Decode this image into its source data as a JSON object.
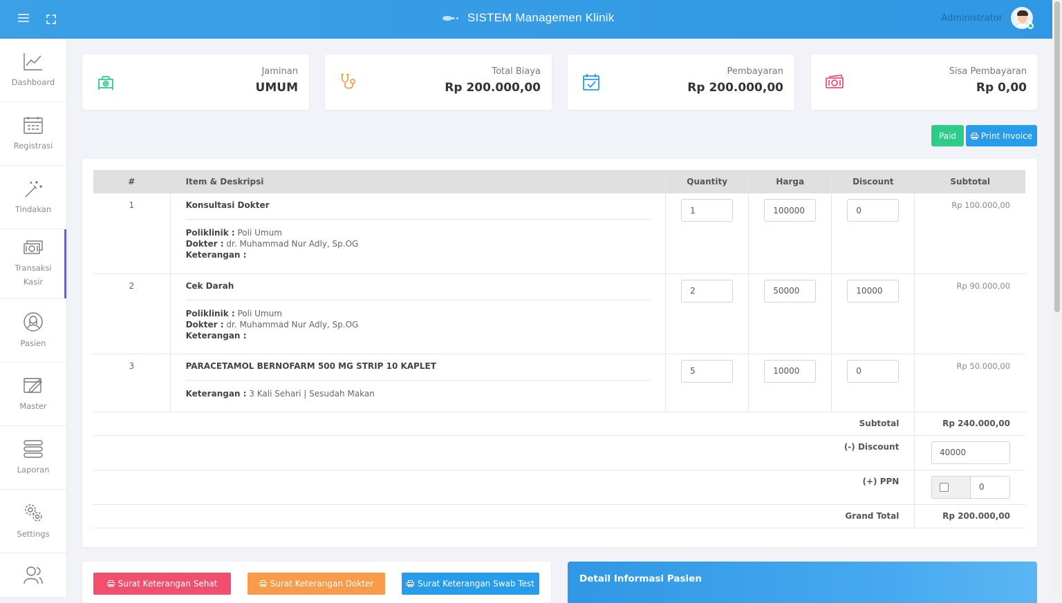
{
  "header": {
    "title": "SISTEM Managemen Klinik",
    "user_name": "Administrator"
  },
  "sidebar": {
    "items": [
      {
        "label": "Dashboard",
        "icon": "line-chart-icon"
      },
      {
        "label": "Registrasi",
        "icon": "calendar-icon"
      },
      {
        "label": "Tindakan",
        "icon": "magic-wand-icon"
      },
      {
        "label": "Transaksi Kasir",
        "icon": "cash-icon",
        "active": true
      },
      {
        "label": "Pasien",
        "icon": "patient-icon"
      },
      {
        "label": "Master",
        "icon": "edit-icon"
      },
      {
        "label": "Laporan",
        "icon": "list-icon"
      },
      {
        "label": "Settings",
        "icon": "gears-icon"
      },
      {
        "label": "",
        "icon": "users-icon"
      }
    ]
  },
  "stats": [
    {
      "title": "Jaminan",
      "value": "UMUM",
      "icon": "ambulance-icon",
      "color": "#2ecc89"
    },
    {
      "title": "Total Biaya",
      "value": "Rp 200.000,00",
      "icon": "stethoscope-icon",
      "color": "#f5a142"
    },
    {
      "title": "Pembayaran",
      "value": "Rp 200.000,00",
      "icon": "calendar-check-icon",
      "color": "#279cea"
    },
    {
      "title": "Sisa Pembayaran",
      "value": "Rp 0,00",
      "icon": "money-icon",
      "color": "#f0506e"
    }
  ],
  "actions": {
    "paid": "Paid",
    "print_invoice": "Print Invoice"
  },
  "table": {
    "headers": {
      "num": "#",
      "item": "Item & Deskripsi",
      "qty": "Quantity",
      "price": "Harga",
      "discount": "Discount",
      "subtotal": "Subtotal"
    },
    "rows": [
      {
        "num": "1",
        "title": "Konsultasi Dokter",
        "poli_label": "Poliklinik :",
        "poli": "Poli Umum",
        "dokter_label": "Dokter :",
        "dokter": "dr. Muhammad Nur Adly, Sp.OG",
        "ket_label": "Keterangan :",
        "ket": "",
        "qty": "1",
        "price": "100000",
        "discount": "0",
        "subtotal": "Rp 100.000,00"
      },
      {
        "num": "2",
        "title": "Cek Darah",
        "poli_label": "Poliklinik :",
        "poli": "Poli Umum",
        "dokter_label": "Dokter :",
        "dokter": "dr. Muhammad Nur Adly, Sp.OG",
        "ket_label": "Keterangan :",
        "ket": "",
        "qty": "2",
        "price": "50000",
        "discount": "10000",
        "subtotal": "Rp 90.000,00"
      },
      {
        "num": "3",
        "title": "PARACETAMOL BERNOFARM 500 MG STRIP 10 KAPLET",
        "ket_label": "Keterangan :",
        "ket": "3 Kali Sehari | Sesudah Makan",
        "qty": "5",
        "price": "10000",
        "discount": "0",
        "subtotal": "Rp 50.000,00"
      }
    ],
    "summary": {
      "subtotal_label": "Subtotal",
      "subtotal": "Rp 240.000,00",
      "discount_label": "(-) Discount",
      "discount": "40000",
      "ppn_label": "(+) PPN",
      "ppn": "0",
      "grand_label": "Grand Total",
      "grand": "Rp 200.000,00"
    }
  },
  "bottom_buttons": [
    {
      "label": "Surat Keterangan Sehat",
      "color": "#f0506e"
    },
    {
      "label": "Surat Keterangan Dokter",
      "color": "#f89b4a"
    },
    {
      "label": "Surat Keterangan Swab Test",
      "color": "#279cea"
    }
  ],
  "detail": {
    "title": "Detail Informasi Pasien"
  }
}
